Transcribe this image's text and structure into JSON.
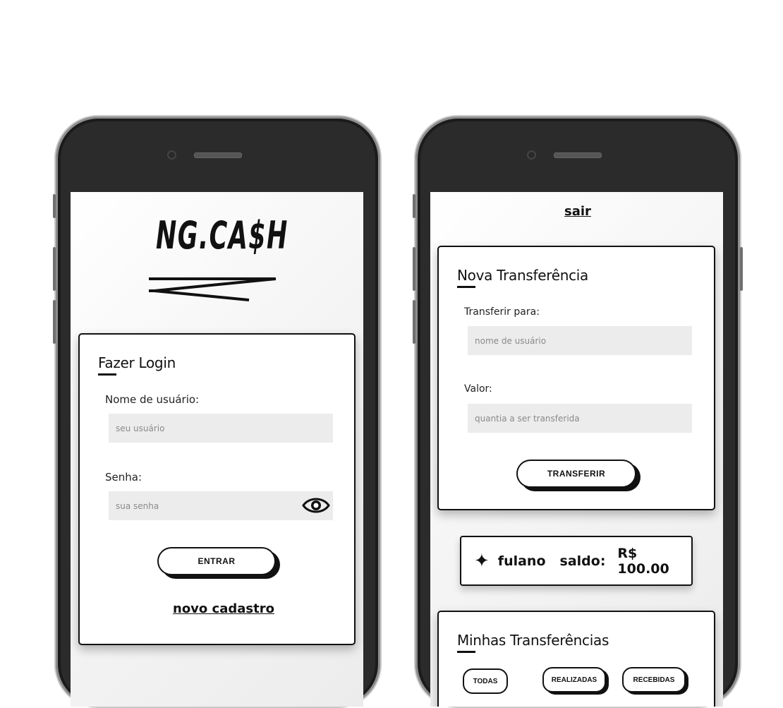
{
  "login": {
    "logo_text": "NG.CA$H",
    "card_title": "Fazer Login",
    "username_label": "Nome de usuário:",
    "username_placeholder": "seu usuário",
    "password_label": "Senha:",
    "password_placeholder": "sua senha",
    "submit_label": "ENTRAR",
    "register_link": "novo cadastro"
  },
  "dashboard": {
    "logout_link": "sair",
    "transfer_card_title": "Nova Transferência",
    "recipient_label": "Transferir para:",
    "recipient_placeholder": "nome de usuário",
    "amount_label": "Valor:",
    "amount_placeholder": "quantia a ser transferida",
    "transfer_button": "TRANSFERIR",
    "balance": {
      "username": "fulano",
      "label": "saldo:",
      "value": "R$ 100.00"
    },
    "history_title": "Minhas Transferências",
    "filters": [
      "TODAS",
      "REALIZADAS",
      "RECEBIDAS"
    ]
  },
  "colors": {
    "phone_body": "#2b2b2b",
    "input_bg": "#ececec",
    "ink": "#111111"
  }
}
